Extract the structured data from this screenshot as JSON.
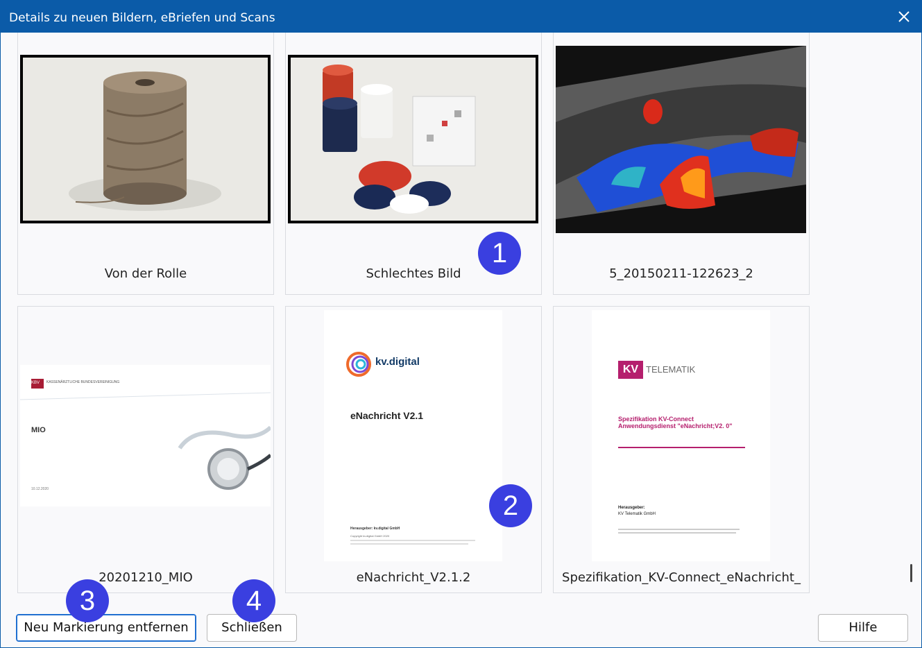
{
  "window": {
    "title": "Details zu neuen Bildern, eBriefen und Scans"
  },
  "items": [
    {
      "label": "Von der Rolle"
    },
    {
      "label": "Schlechtes Bild"
    },
    {
      "label": "5_20150211-122623_2"
    },
    {
      "label": "20201210_MIO"
    },
    {
      "label": "eNachricht_V2.1.2"
    },
    {
      "label": "Spezifikation_KV-Connect_eNachricht_"
    }
  ],
  "thumbs": {
    "mio": {
      "logo": "KBV",
      "org": "KASSENÄRZTLICHE BUNDESVEREINIGUNG",
      "title": "MIO",
      "date": "10.12.2020"
    },
    "kvdigital": {
      "logo": "kv.digital",
      "title": "eNachricht V2.1",
      "publisher": "Herausgeber: kv.digital GmbH",
      "copyright": "Copyright kv.digital GmbH 2020"
    },
    "telematik": {
      "logo_mark": "KV",
      "logo_text": "TELEMATIK",
      "title": "Spezifikation KV-Connect Anwendungsdienst \"eNachricht;V2. 0\"",
      "publisher_label": "Herausgeber:",
      "publisher": "KV Telematik GmbH"
    }
  },
  "badges": [
    "1",
    "2",
    "3",
    "4"
  ],
  "buttons": {
    "remove": "Neu Markierung entfernen",
    "close": "Schließen",
    "help": "Hilfe"
  },
  "colors": {
    "titlebar": "#0b5ba8",
    "badge": "#3a3fe0",
    "accent": "#1f6fd0"
  }
}
